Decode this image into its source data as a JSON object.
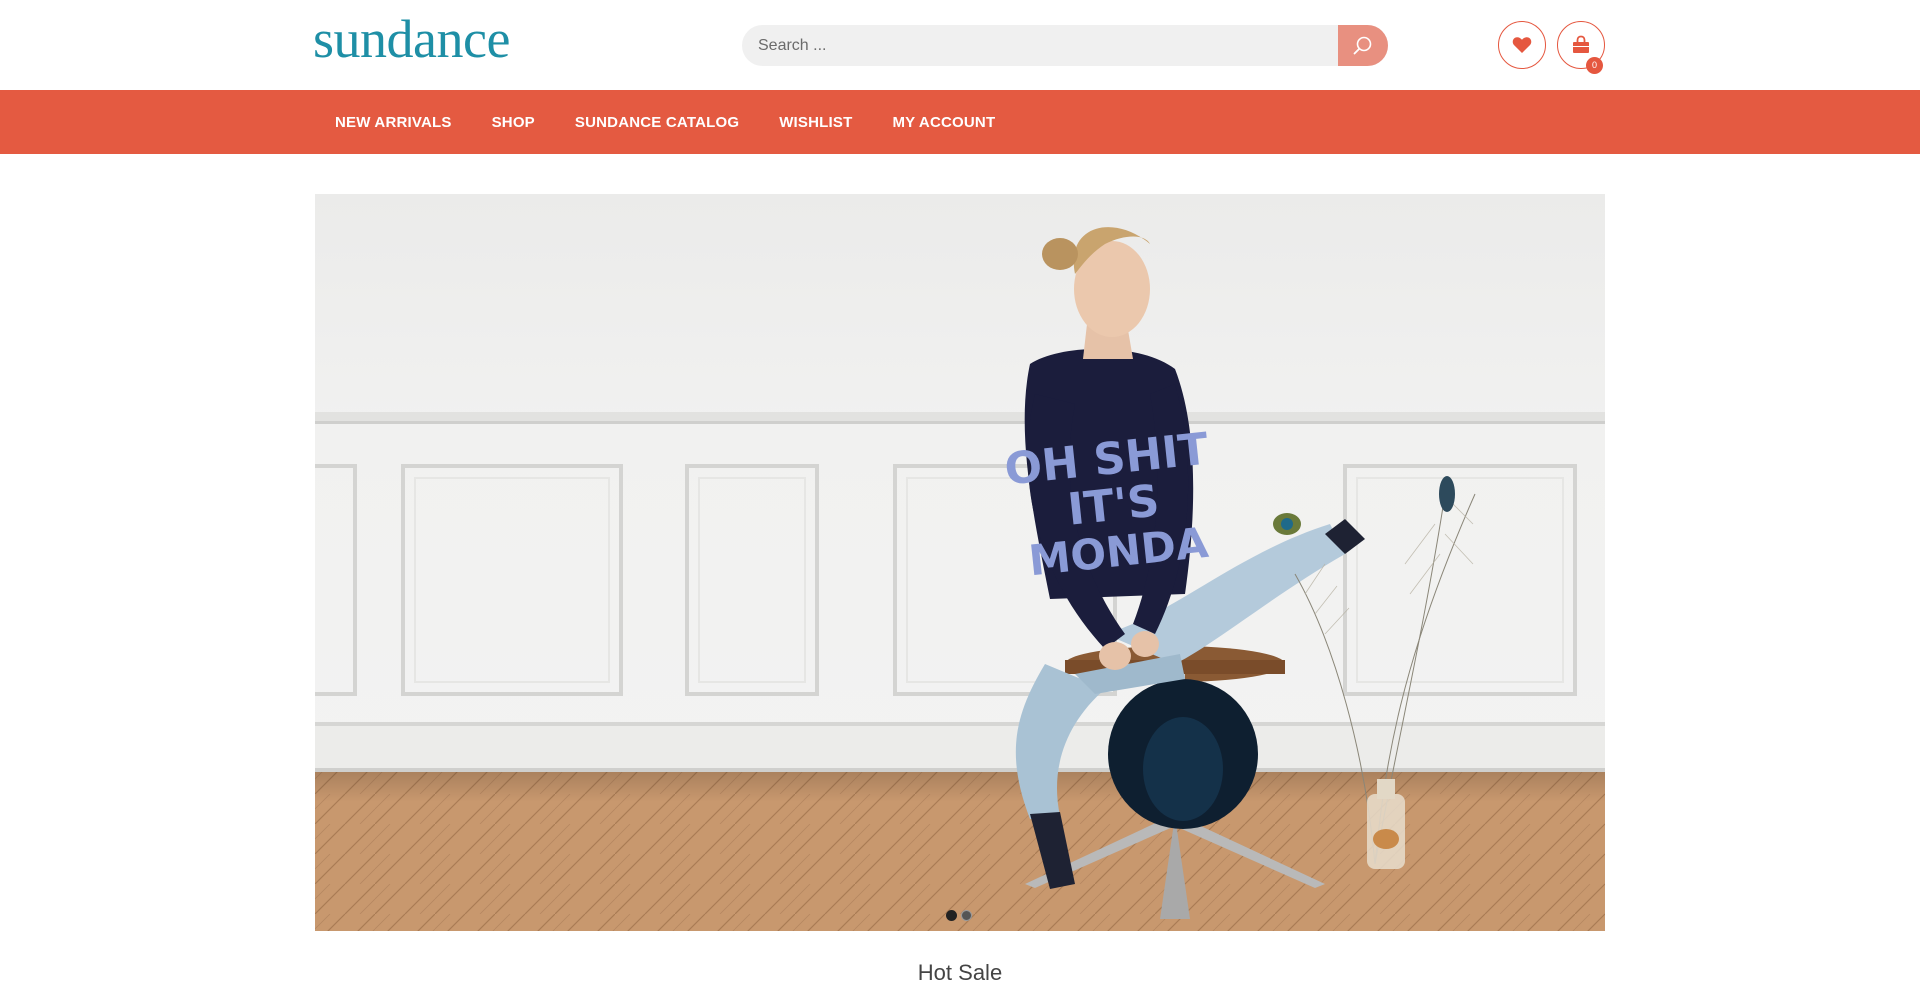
{
  "header": {
    "logo_text": "sundance",
    "search": {
      "placeholder": "Search ...",
      "icon": "search-icon"
    },
    "wishlist_icon": "heart-icon",
    "cart_icon": "shopping-bag-icon",
    "cart_count": "0"
  },
  "nav": {
    "items": [
      {
        "label": "NEW ARRIVALS"
      },
      {
        "label": "SHOP"
      },
      {
        "label": "SUNDANCE CATALOG"
      },
      {
        "label": "WISHLIST"
      },
      {
        "label": "MY ACCOUNT"
      }
    ]
  },
  "hero": {
    "sweater_text": [
      "OH SHIT",
      "IT'S",
      "MONDA"
    ],
    "slides": 2,
    "active_slide": 1
  },
  "section": {
    "title": "Hot Sale"
  },
  "colors": {
    "brand_teal": "#1e8fa6",
    "accent_coral": "#e45a41",
    "search_btn": "#e89080"
  }
}
